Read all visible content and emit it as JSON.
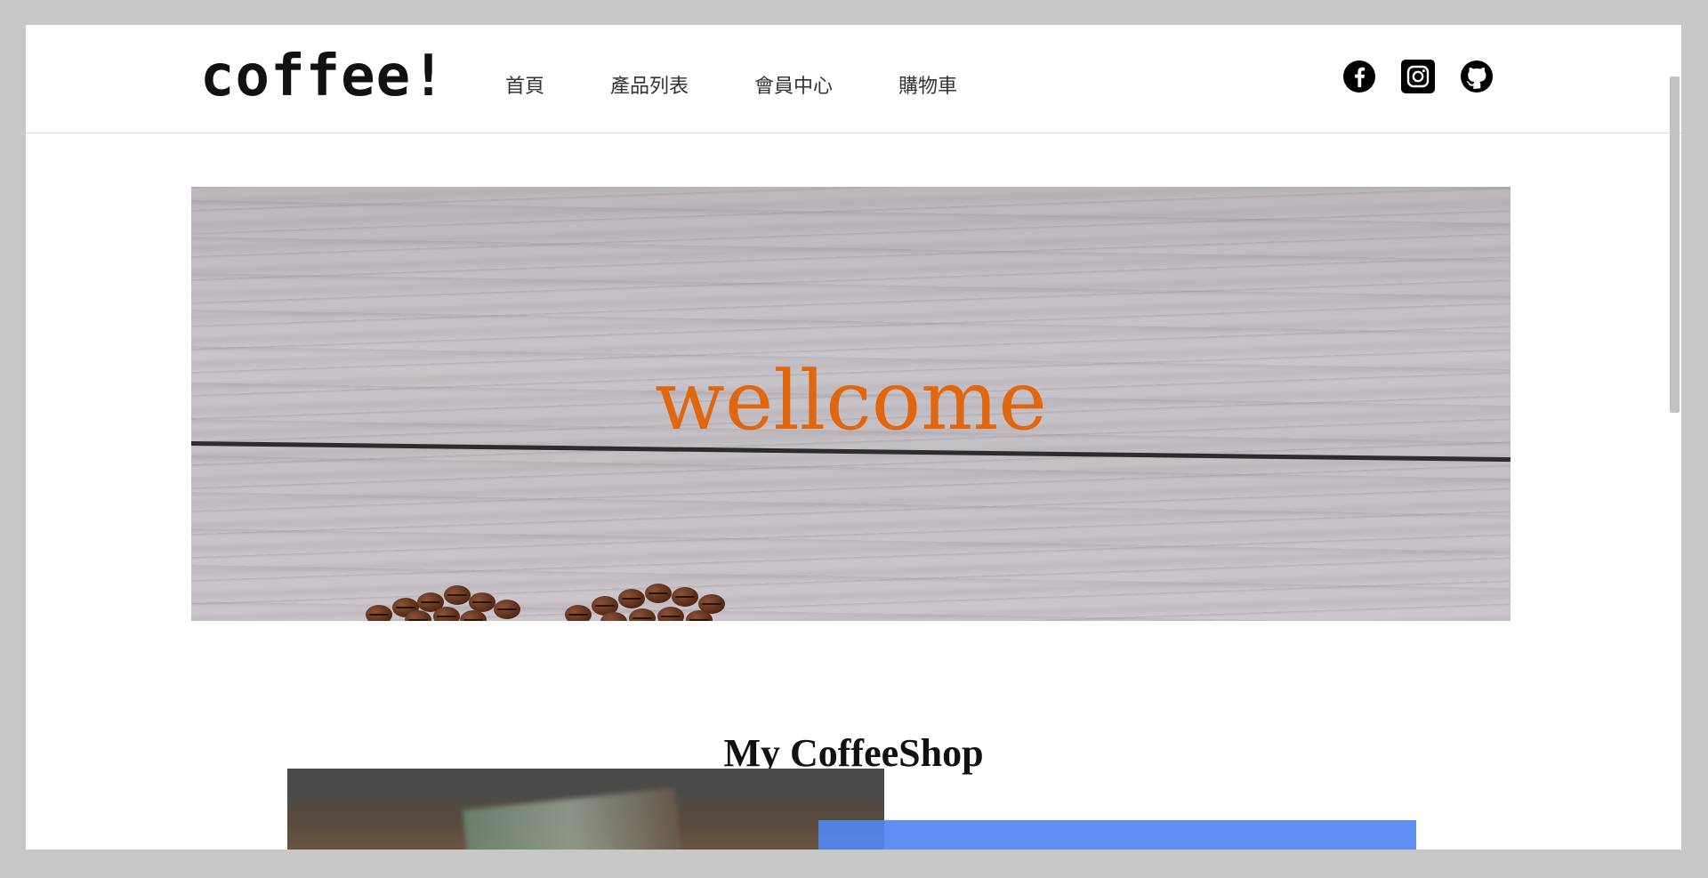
{
  "brand": {
    "logo_text": "coffee!"
  },
  "nav": {
    "links": [
      {
        "label": "首頁"
      },
      {
        "label": "產品列表"
      },
      {
        "label": "會員中心"
      },
      {
        "label": "購物車"
      }
    ]
  },
  "social": {
    "icons": [
      {
        "name": "facebook-icon"
      },
      {
        "name": "instagram-icon"
      },
      {
        "name": "github-icon"
      }
    ]
  },
  "hero": {
    "title": "wellcome"
  },
  "section": {
    "title": "My CoffeeShop"
  },
  "colors": {
    "hero_title": "#e0670f",
    "card_blue": "#5087f0"
  }
}
